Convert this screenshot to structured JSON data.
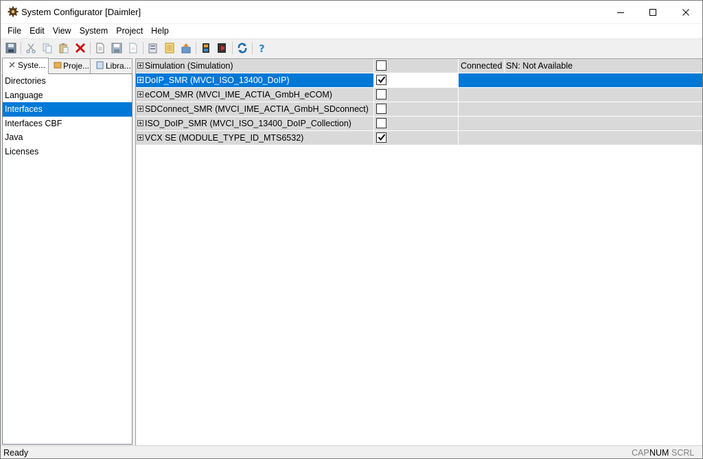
{
  "window": {
    "title": "System Configurator [Daimler]"
  },
  "menu": [
    "File",
    "Edit",
    "View",
    "System",
    "Project",
    "Help"
  ],
  "toolbar": {
    "buttons": [
      "save-icon",
      "cut-icon",
      "copy-icon",
      "paste-icon",
      "delete-icon",
      "new-document-icon",
      "save-document-icon",
      "document-icon",
      "properties-icon",
      "print-icon",
      "export-icon",
      "book-icon",
      "run-icon",
      "refresh-icon",
      "help-icon"
    ]
  },
  "left": {
    "tabs": [
      "Syste...",
      "Proje...",
      "Libra..."
    ],
    "items": [
      "Directories",
      "Language",
      "Interfaces",
      "Interfaces CBF",
      "Java",
      "Licenses"
    ],
    "selected": "Interfaces"
  },
  "grid": {
    "rows": [
      {
        "name": "Simulation (Simulation)",
        "checked": false,
        "status": "Connected",
        "sn": "SN: Not Available"
      },
      {
        "name": "DoIP_SMR (MVCI_ISO_13400_DoIP)",
        "checked": true,
        "status": "",
        "sn": ""
      },
      {
        "name": "eCOM_SMR (MVCI_IME_ACTIA_GmbH_eCOM)",
        "checked": false,
        "status": "",
        "sn": ""
      },
      {
        "name": "SDConnect_SMR (MVCI_IME_ACTIA_GmbH_SDconnect)",
        "checked": false,
        "status": "",
        "sn": ""
      },
      {
        "name": "ISO_DoIP_SMR (MVCI_ISO_13400_DoIP_Collection)",
        "checked": false,
        "status": "",
        "sn": ""
      },
      {
        "name": "VCX SE (MODULE_TYPE_ID_MTS6532)",
        "checked": true,
        "status": "",
        "sn": ""
      }
    ]
  },
  "status": {
    "text": "Ready",
    "cap": "CAP",
    "num": "NUM",
    "scrl": "SCRL"
  },
  "colors": {
    "selection": "#0078d7",
    "row_bg": "#d9d9d9"
  }
}
